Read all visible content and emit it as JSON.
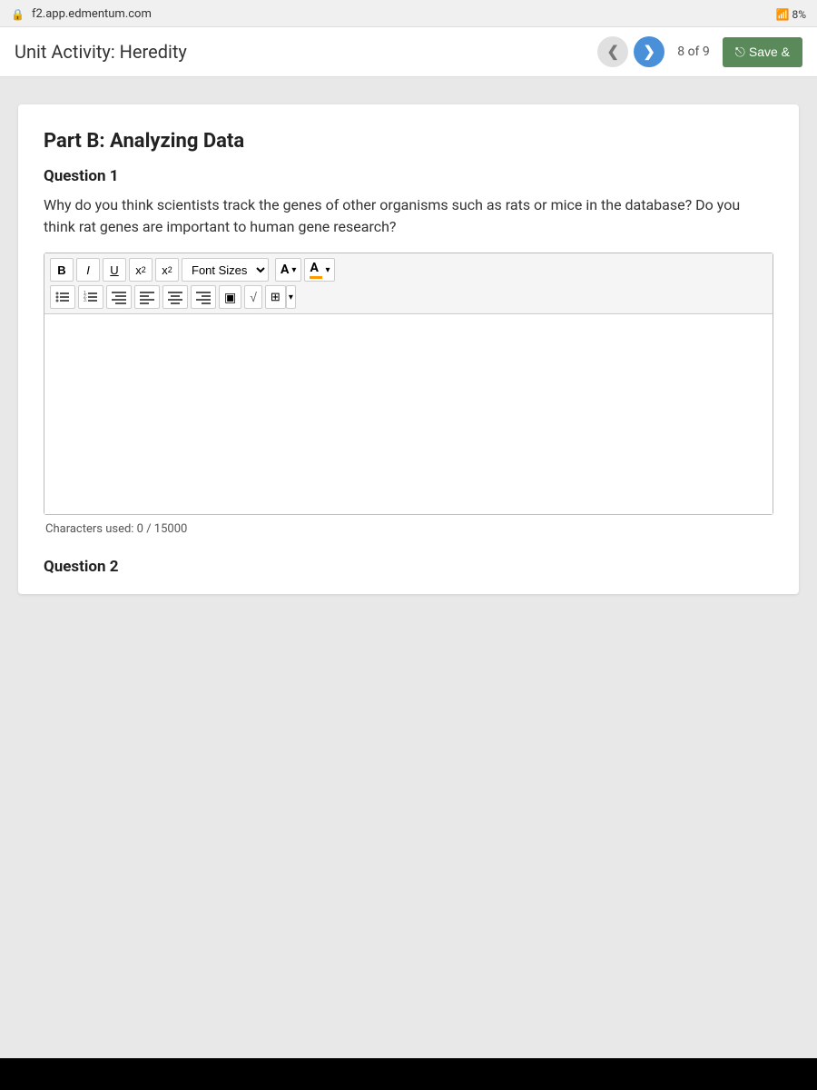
{
  "browser": {
    "url": "f2.app.edmentum.com",
    "wifi_signal": "8%",
    "lock_icon": "🔒"
  },
  "header": {
    "title": "Unit Activity: Heredity",
    "prev_btn_label": "❮",
    "next_btn_label": "❯",
    "page_current": "8",
    "page_of": "of",
    "page_total": "9",
    "save_label": "Save &",
    "save_icon": "⎋"
  },
  "main": {
    "part_title": "Part B: Analyzing Data",
    "question1": {
      "label": "Question 1",
      "text": "Why do you think scientists track the genes of other organisms such as rats or mice in the database? Do you think rat genes are important to human gene research?",
      "char_count_label": "Characters used: 0 / 15000",
      "toolbar": {
        "bold": "B",
        "italic": "I",
        "underline": "U",
        "superscript": "x²",
        "subscript": "x₂",
        "font_sizes": "Font Sizes",
        "font_color": "A",
        "highlight_color": "A",
        "list_unordered": "≡",
        "list_ordered": "≡",
        "indent_left": "≡",
        "align_left": "≡",
        "align_center": "≡",
        "align_right": "≡",
        "image_btn": "▣",
        "formula_btn": "√",
        "table_btn": "⊞"
      }
    },
    "question2": {
      "label": "Question 2"
    }
  }
}
